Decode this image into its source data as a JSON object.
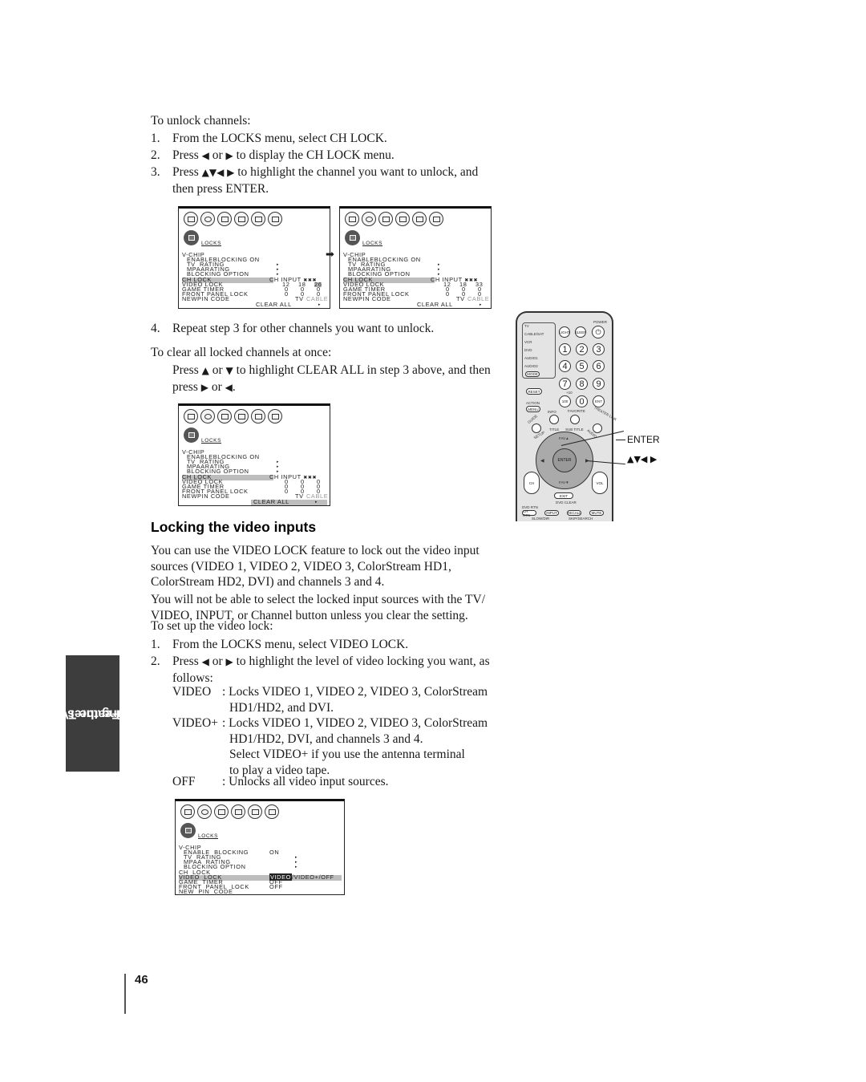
{
  "intro": {
    "heading": "To unlock channels:",
    "steps": [
      {
        "num": "1.",
        "text": "From the LOCKS menu, select CH LOCK."
      },
      {
        "num": "2.",
        "pre": "Press ",
        "arrows": "◀",
        "mid": " or ",
        "arrows2": "▶",
        "post": " to display the CH LOCK menu."
      },
      {
        "num": "3.",
        "pre": "Press ",
        "arrows": "▲▼◀ ▶",
        "post": " to highlight the channel you want to unlock, and",
        "line2": "then press ENTER."
      },
      {
        "num": "4.",
        "text": "Repeat step 3 for other channels you want to unlock."
      }
    ]
  },
  "clear_all": {
    "heading": "To clear all locked channels at once:",
    "line1_pre": "Press ",
    "up": "▲",
    "or1": " or ",
    "down": "▼",
    "line1_post": " to highlight CLEAR ALL in step 3 above, and then",
    "line2_pre": "press ",
    "right": "▶",
    "or2": " or ",
    "left": "◀",
    "line2_post": "."
  },
  "osd_common": {
    "menu_title": "LOCKS",
    "vchip": "V-CHIP",
    "enable_blocking": "ENABLEBLOCKING",
    "enable_value": "ON",
    "tv_rating": "TV  RATING",
    "mpaa_rating": "MPAARATING",
    "blocking_option": "BLOCKING OPTION",
    "ch_lock": "CH LOCK",
    "video_lock": "VIDEO LOCK",
    "game_timer": "GAME TIMER",
    "front_panel_lock": "FRONT PANEL LOCK",
    "new_pin_code": "NEWPIN CODE",
    "ch_input": "CH INPUT",
    "tv": "TV",
    "cable": "CABLE",
    "clear_all": "CLEAR ALL",
    "submenu_arrow": "▸",
    "next_arrow": "➡"
  },
  "osd_screens": [
    {
      "rows": [
        [
          "12",
          "18",
          "26"
        ],
        [
          "0",
          "0",
          "0"
        ],
        [
          "0",
          "0",
          "0"
        ]
      ],
      "highlight_cell": "26"
    },
    {
      "rows": [
        [
          "12",
          "18",
          "33"
        ],
        [
          "0",
          "0",
          "0"
        ],
        [
          "0",
          "0",
          "0"
        ]
      ]
    },
    {
      "rows": [
        [
          "0",
          "0",
          "0"
        ],
        [
          "0",
          "0",
          "0"
        ],
        [
          "0",
          "0",
          "0"
        ]
      ],
      "highlight": "CLEAR ALL"
    }
  ],
  "osd_video_lock": {
    "menu_title": "LOCKS",
    "vchip": "V-CHIP",
    "enable_blocking": "ENABLE  BLOCKING",
    "enable_value": "ON",
    "tv_rating": "TV  RATING",
    "mpaa_rating": "MPAA  RATING",
    "blocking_option": "BLOCKING OPTION",
    "ch_lock": "CH  LOCK",
    "video_lock": "VIDEO  LOCK",
    "video_lock_selected": "VIDEO",
    "video_lock_rest": "/VIDEO+/OFF",
    "game_timer": "GAME  TIMER",
    "game_timer_value": "OFF",
    "front_panel_lock": "FRONT  PANEL  LOCK",
    "front_panel_value": "OFF",
    "new_pin_code": "NEW  PIN  CODE"
  },
  "remote": {
    "modes": [
      "TV",
      "CABLE/SAT",
      "VCR",
      "DVD",
      "AUDIO1",
      "AUDIO2"
    ],
    "mode_button": "MODE",
    "power": "POWER",
    "light": "LIGHT",
    "sleep": "SLEEP",
    "digits": [
      "1",
      "2",
      "3",
      "4",
      "5",
      "6",
      "7",
      "8",
      "9"
    ],
    "reset": "RESET",
    "hundred": "100",
    "minus10": "+10",
    "zero": "0",
    "ent": "ENT",
    "action": "ACTION",
    "menu": "MENU",
    "info": "INFO",
    "favorite": "FAVORITE",
    "theater": "THEATER LINK",
    "guide": "GUIDE",
    "setup": "SETUP",
    "title": "TITLE",
    "subtitle": "SUB TITLE",
    "audio": "AUDIO",
    "fav_up": "FAV▲",
    "fav_down": "FAV▼",
    "enter": "ENTER",
    "ch": "CH",
    "vol": "VOL",
    "exit": "EXIT",
    "dvd_clear": "DVD CLEAR",
    "ch_rtn_top": "DVD RTN",
    "ch_rtn": "CH RTN",
    "input": "INPUT",
    "recall": "RECALL",
    "mute": "MUTE",
    "slow_dir": "SLOW/DIR",
    "skip_search": "SKIP/SEARCH"
  },
  "callouts": {
    "enter": "ENTER",
    "arrows": "▲▼◀ ▶"
  },
  "section": {
    "title": "Locking the video inputs",
    "para1": [
      "You can use the VIDEO LOCK feature to lock out the video input",
      "sources (VIDEO 1, VIDEO 2, VIDEO 3, ColorStream HD1,",
      "ColorStream HD2, DVI) and channels 3 and 4."
    ],
    "para2": [
      "You will not be able to select the locked input sources with the TV/",
      "VIDEO, INPUT, or Channel button unless you clear the setting."
    ],
    "setup_heading": "To set up the video lock:",
    "step1": "From the LOCKS menu, select VIDEO LOCK.",
    "step2_pre": "Press ",
    "step2_left": "◀",
    "step2_or": " or ",
    "step2_right": "▶",
    "step2_post": " to highlight the level of video locking you want, as",
    "step2_line2": "follows:",
    "options": [
      {
        "key": "VIDEO",
        "lines": [
          ": Locks VIDEO 1, VIDEO 2, VIDEO 3, ColorStream",
          "HD1/HD2, and DVI."
        ]
      },
      {
        "key": "VIDEO+",
        "lines": [
          ": Locks VIDEO 1, VIDEO 2, VIDEO 3, ColorStream",
          "HD1/HD2, DVI, and channels 3 and 4.",
          "Select VIDEO+ if you use the antenna terminal",
          "to play a video tape."
        ]
      },
      {
        "key": "OFF",
        "lines": [
          ": Unlocks all video input sources."
        ]
      }
    ]
  },
  "side_tab": {
    "line1": "Using the TV’s",
    "line2": "Features"
  },
  "page_number": "46"
}
